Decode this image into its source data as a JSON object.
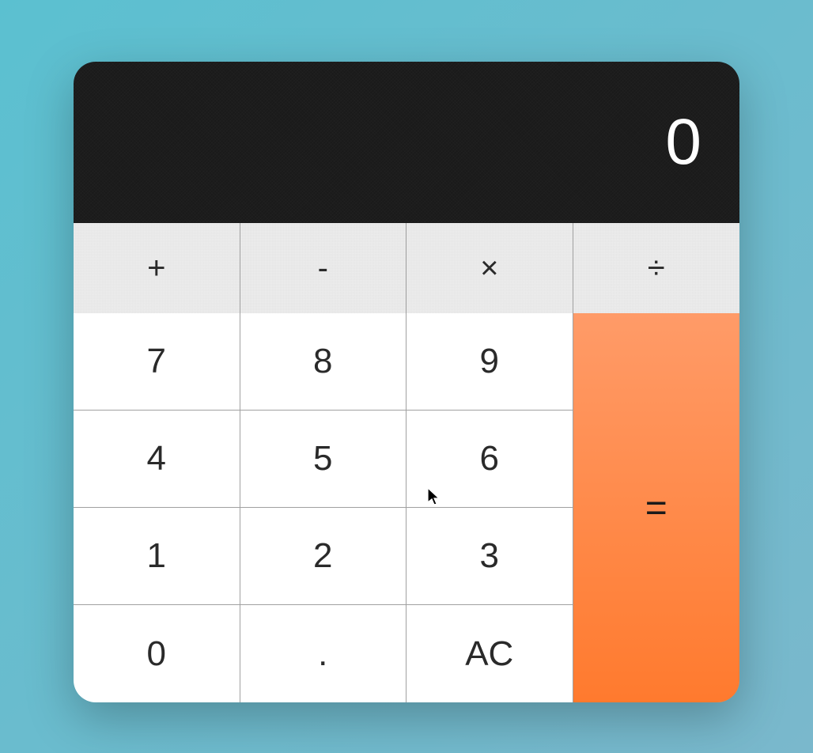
{
  "display": {
    "value": "0"
  },
  "operators": {
    "add": "+",
    "subtract": "-",
    "multiply": "×",
    "divide": "÷"
  },
  "numpad": {
    "seven": "7",
    "eight": "8",
    "nine": "9",
    "four": "4",
    "five": "5",
    "six": "6",
    "one": "1",
    "two": "2",
    "three": "3",
    "zero": "0",
    "decimal": ".",
    "clear": "AC"
  },
  "equals": "="
}
